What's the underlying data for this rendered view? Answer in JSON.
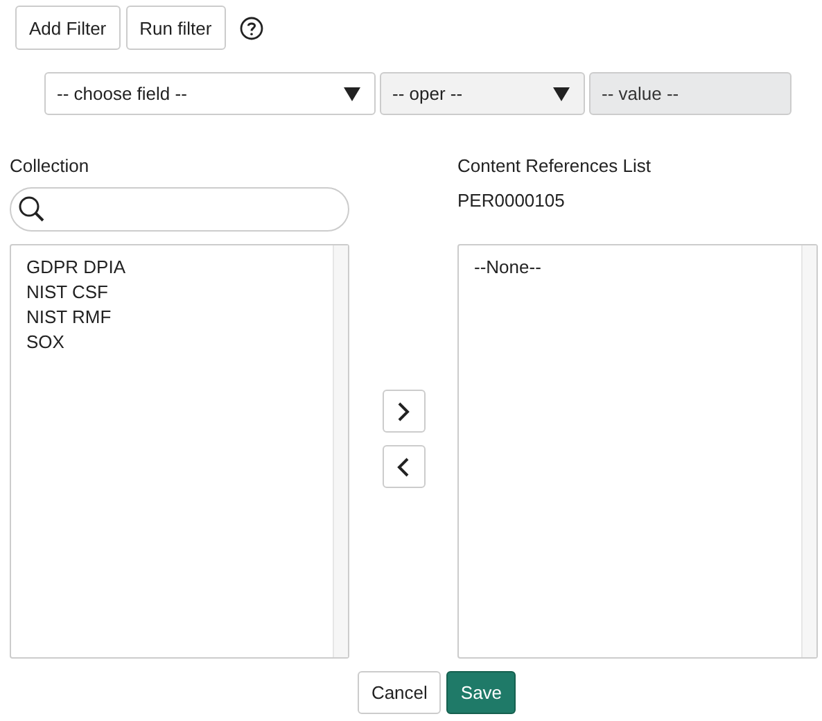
{
  "toolbar": {
    "buttons": [
      "Add Filter",
      "Run filter"
    ]
  },
  "filter": {
    "field": "-- choose field --",
    "operator": "-- oper --",
    "value_placeholder": "-- value --",
    "value_disabled": true
  },
  "collection": {
    "label": "Collection",
    "items": [
      {
        "label": "GDPR DPIA",
        "selected": false
      },
      {
        "label": "NIST CSF",
        "selected": false
      },
      {
        "label": "NIST RMF",
        "selected": false
      },
      {
        "label": "SOX",
        "selected": false
      }
    ]
  },
  "content_references": {
    "label": "Content References List",
    "record": "PER0000105",
    "items": [
      {
        "label": "--None--",
        "selected": false
      }
    ]
  },
  "actions": [
    {
      "label": "Cancel",
      "kind": "secondary"
    },
    {
      "label": "Save",
      "kind": "primary"
    }
  ]
}
